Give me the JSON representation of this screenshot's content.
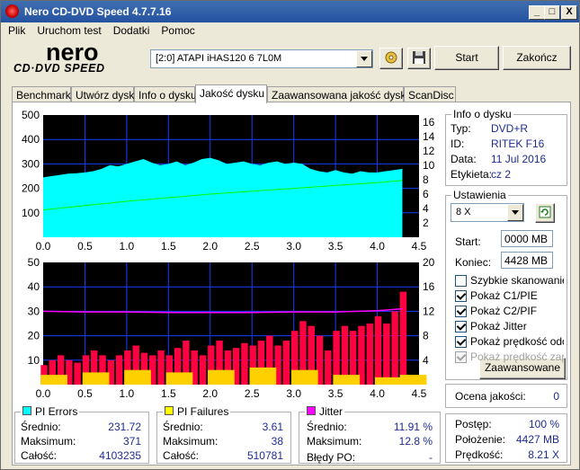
{
  "window": {
    "title": "Nero CD-DVD Speed 4.7.7.16",
    "min": "_",
    "max": "□",
    "close": "X"
  },
  "menu": [
    "Plik",
    "Uruchom test",
    "Dodatki",
    "Pomoc"
  ],
  "logo": {
    "top": "nero",
    "bottom": "CD·DVD SPEED"
  },
  "drive": {
    "selected": "[2:0]   ATAPI iHAS120   6 7L0M"
  },
  "toolbar": {
    "start": "Start",
    "close": "Zakończ"
  },
  "tabs": [
    "Benchmark",
    "Utwórz dysk",
    "Info o dysku",
    "Jakość dysku",
    "Zaawansowana jakość dysku",
    "ScanDisc"
  ],
  "active_tab": 3,
  "disc_info": {
    "title": "Info o dysku",
    "rows": [
      {
        "label": "Typ:",
        "value": "DVD+R"
      },
      {
        "label": "ID:",
        "value": "RITEK F16"
      },
      {
        "label": "Data:",
        "value": "11 Jul 2016"
      },
      {
        "label": "Etykieta:",
        "value": "cz 2"
      }
    ]
  },
  "settings": {
    "title": "Ustawienia",
    "speed": "8 X",
    "start_label": "Start:",
    "start_value": "0000 MB",
    "end_label": "Koniec:",
    "end_value": "4428 MB",
    "checks": [
      {
        "label": "Szybkie skanowanie",
        "checked": false,
        "disabled": false
      },
      {
        "label": "Pokaż C1/PIE",
        "checked": true,
        "disabled": false
      },
      {
        "label": "Pokaż C2/PIF",
        "checked": true,
        "disabled": false
      },
      {
        "label": "Pokaż Jitter",
        "checked": true,
        "disabled": false
      },
      {
        "label": "Pokaż prędkość odczy",
        "checked": true,
        "disabled": false
      },
      {
        "label": "Pokaż prędkość zapisu",
        "checked": true,
        "disabled": true
      }
    ],
    "advanced": "Zaawansowane"
  },
  "quality": {
    "label": "Ocena jakości:",
    "value": "0"
  },
  "progress": {
    "rows": [
      {
        "label": "Postęp:",
        "value": "100 %"
      },
      {
        "label": "Położenie:",
        "value": "4427 MB"
      },
      {
        "label": "Prędkość:",
        "value": "8.21 X"
      }
    ]
  },
  "pi_errors": {
    "title": "PI Errors",
    "color": "#00ffff",
    "rows": [
      {
        "label": "Średnio:",
        "value": "231.72"
      },
      {
        "label": "Maksimum:",
        "value": "371"
      },
      {
        "label": "Całość:",
        "value": "4103235"
      }
    ]
  },
  "pi_failures": {
    "title": "PI Failures",
    "color": "#ffff00",
    "rows": [
      {
        "label": "Średnio:",
        "value": "3.61"
      },
      {
        "label": "Maksimum:",
        "value": "38"
      },
      {
        "label": "Całość:",
        "value": "510781"
      }
    ]
  },
  "jitter": {
    "title": "Jitter",
    "color": "#ff00ff",
    "rows": [
      {
        "label": "Średnio:",
        "value": "11.91 %"
      },
      {
        "label": "Maksimum:",
        "value": "12.8 %"
      },
      {
        "label": "Błędy PO:",
        "value": "-"
      }
    ]
  },
  "chart_data": [
    {
      "type": "area",
      "x_ticks": [
        "0.0",
        "0.5",
        "1.0",
        "1.5",
        "2.0",
        "2.5",
        "3.0",
        "3.5",
        "4.0",
        "4.5"
      ],
      "y_ticks_left": [
        "100",
        "200",
        "300",
        "400",
        "500"
      ],
      "y_ticks_right": [
        "2",
        "4",
        "6",
        "8",
        "10",
        "12",
        "14",
        "16"
      ],
      "xlim": [
        0,
        4.5
      ],
      "ylim_left": [
        0,
        500
      ],
      "ylim_right": [
        0,
        17
      ],
      "series": [
        {
          "color": "#00ffff",
          "x": [
            0.0,
            0.1,
            0.2,
            0.3,
            0.4,
            0.5,
            0.6,
            0.7,
            0.8,
            0.9,
            1.0,
            1.1,
            1.2,
            1.3,
            1.4,
            1.5,
            1.6,
            1.7,
            1.8,
            1.9,
            2.0,
            2.1,
            2.2,
            2.3,
            2.4,
            2.5,
            2.6,
            2.7,
            2.8,
            2.9,
            3.0,
            3.1,
            3.2,
            3.3,
            3.4,
            3.5,
            3.6,
            3.7,
            3.8,
            3.9,
            4.0,
            4.1,
            4.2,
            4.3
          ],
          "y": [
            245,
            250,
            255,
            260,
            262,
            265,
            270,
            280,
            295,
            290,
            300,
            310,
            320,
            305,
            295,
            300,
            310,
            295,
            305,
            320,
            325,
            315,
            300,
            305,
            310,
            300,
            295,
            305,
            310,
            300,
            305,
            300,
            280,
            270,
            265,
            275,
            265,
            260,
            270,
            265,
            265,
            270,
            275,
            280
          ]
        },
        {
          "color": "#00ff00",
          "x": [
            0.0,
            0.5,
            1.0,
            1.5,
            2.0,
            2.5,
            3.0,
            3.5,
            4.0,
            4.3
          ],
          "y": [
            3.8,
            4.4,
            5.0,
            5.5,
            6.0,
            6.4,
            6.8,
            7.2,
            7.6,
            7.9
          ]
        }
      ]
    },
    {
      "type": "bar",
      "x_ticks": [
        "0.0",
        "0.5",
        "1.0",
        "1.5",
        "2.0",
        "2.5",
        "3.0",
        "3.5",
        "4.0",
        "4.5"
      ],
      "y_ticks_left": [
        "10",
        "20",
        "30",
        "40",
        "50"
      ],
      "y_ticks_right": [
        "4",
        "8",
        "12",
        "16",
        "20"
      ],
      "xlim": [
        0,
        4.5
      ],
      "ylim_left": [
        0,
        50
      ],
      "ylim_right": [
        0,
        20
      ],
      "series": [
        {
          "color": "#ff0040",
          "x": [
            0.0,
            0.1,
            0.2,
            0.3,
            0.4,
            0.5,
            0.6,
            0.7,
            0.8,
            0.9,
            1.0,
            1.1,
            1.2,
            1.3,
            1.4,
            1.5,
            1.6,
            1.7,
            1.8,
            1.9,
            2.0,
            2.1,
            2.2,
            2.3,
            2.4,
            2.5,
            2.6,
            2.7,
            2.8,
            2.9,
            3.0,
            3.1,
            3.2,
            3.3,
            3.4,
            3.5,
            3.6,
            3.7,
            3.8,
            3.9,
            4.0,
            4.1,
            4.2,
            4.3
          ],
          "y": [
            8,
            10,
            12,
            10,
            9,
            12,
            14,
            12,
            10,
            12,
            14,
            16,
            13,
            12,
            14,
            12,
            15,
            18,
            14,
            12,
            16,
            18,
            14,
            15,
            17,
            16,
            18,
            20,
            16,
            18,
            22,
            26,
            24,
            20,
            14,
            22,
            24,
            22,
            24,
            25,
            28,
            25,
            30,
            38
          ]
        },
        {
          "color": "#ffd000",
          "x": [
            0.0,
            0.5,
            1.0,
            1.5,
            2.0,
            2.5,
            3.0,
            3.5,
            4.0,
            4.3
          ],
          "y": [
            4,
            5,
            6,
            5,
            6,
            7,
            6,
            4,
            3,
            4
          ]
        },
        {
          "color": "#ff00ff",
          "x": [
            0.0,
            0.5,
            1.0,
            1.5,
            2.0,
            2.5,
            3.0,
            3.5,
            4.0,
            4.3
          ],
          "y": [
            12.0,
            11.9,
            11.9,
            11.8,
            11.8,
            11.8,
            11.9,
            11.9,
            12.1,
            12.4
          ]
        }
      ]
    }
  ]
}
